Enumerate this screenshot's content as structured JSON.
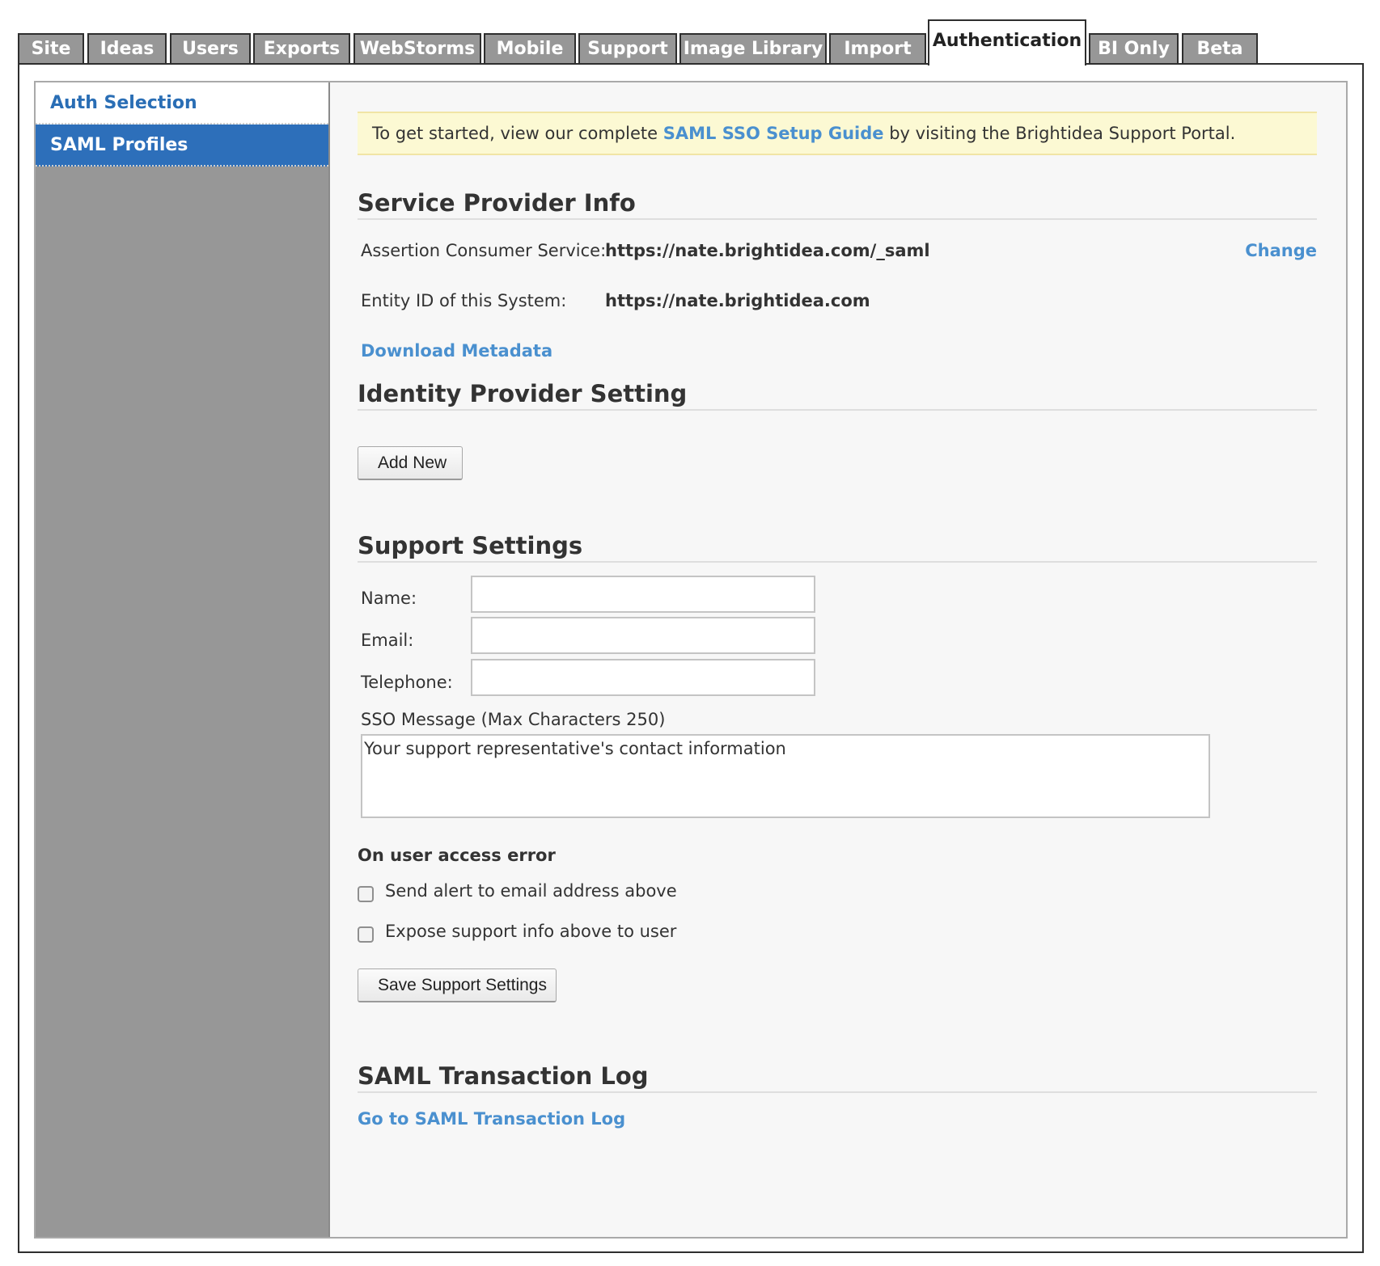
{
  "tabs": [
    {
      "id": "site",
      "label": "Site"
    },
    {
      "id": "ideas",
      "label": "Ideas"
    },
    {
      "id": "users",
      "label": "Users"
    },
    {
      "id": "exports",
      "label": "Exports"
    },
    {
      "id": "webstorms",
      "label": "WebStorms"
    },
    {
      "id": "mobile",
      "label": "Mobile"
    },
    {
      "id": "support",
      "label": "Support"
    },
    {
      "id": "image-library",
      "label": "Image Library"
    },
    {
      "id": "import",
      "label": "Import"
    },
    {
      "id": "authentication",
      "label": "Authentication",
      "active": true
    },
    {
      "id": "bi-only",
      "label": "BI Only"
    },
    {
      "id": "beta",
      "label": "Beta"
    }
  ],
  "sidebar": {
    "items": [
      {
        "label": "Auth Selection"
      },
      {
        "label": "SAML Profiles",
        "selected": true
      }
    ]
  },
  "notice": {
    "prefix": "To get started, view our complete",
    "link": "SAML SSO Setup Guide",
    "suffix": "by visiting the Brightidea Support Portal."
  },
  "service_provider": {
    "title": "Service Provider Info",
    "acs_label": "Assertion Consumer Service:",
    "acs_value": "https://nate.brightidea.com/_saml",
    "change_link": "Change",
    "entity_label": "Entity ID of this System:",
    "entity_value": "https://nate.brightidea.com",
    "download_link": "Download Metadata"
  },
  "identity_provider": {
    "title": "Identity Provider Setting",
    "add_new": "Add New"
  },
  "support_settings": {
    "title": "Support Settings",
    "name_label": "Name:",
    "name_value": "",
    "email_label": "Email:",
    "email_value": "",
    "telephone_label": "Telephone:",
    "telephone_value": "",
    "sso_message_label": "SSO Message (Max Characters 250)",
    "sso_message_value": "Your support representative's contact information",
    "access_error_heading": "On user access error",
    "send_alert_label": "Send alert to email address above",
    "send_alert_checked": false,
    "expose_info_label": "Expose support info above to user",
    "expose_info_checked": false,
    "save_button": "Save Support Settings"
  },
  "transaction_log": {
    "title": "SAML Transaction Log",
    "link": "Go to SAML Transaction Log"
  },
  "colors": {
    "tab_inactive": "#979797",
    "link_blue": "#4a90cf",
    "sidebar_selected": "#2d6fba",
    "notice_bg": "#fcf9d3"
  }
}
